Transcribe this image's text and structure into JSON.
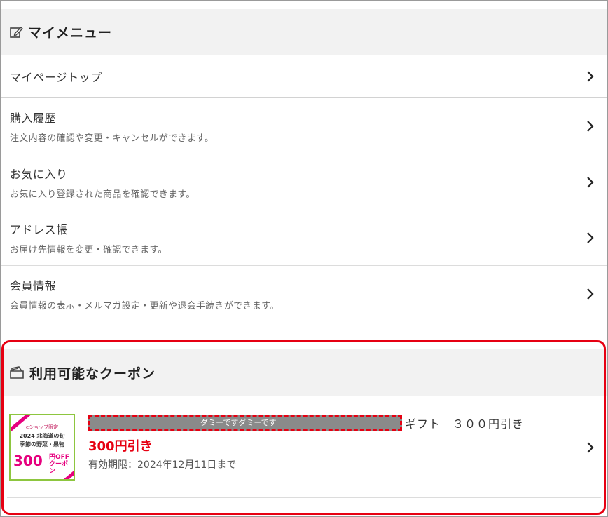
{
  "my_menu": {
    "title": "マイメニュー",
    "icon": "edit-note-icon",
    "items": [
      {
        "label": "マイページトップ",
        "description": ""
      },
      {
        "label": "購入履歴",
        "description": "注文内容の確認や変更・キャンセルができます。"
      },
      {
        "label": "お気に入り",
        "description": "お気に入り登録された商品を確認できます。"
      },
      {
        "label": "アドレス帳",
        "description": "お届け先情報を変更・確認できます。"
      },
      {
        "label": "会員情報",
        "description": "会員情報の表示・メルマガ設定・更新や退会手続きができます。"
      }
    ]
  },
  "coupons": {
    "title": "利用可能なクーポン",
    "icon": "coupon-icon",
    "items": [
      {
        "thumbnail": {
          "tag": "eショップ限定",
          "year_line": "2024 北海道の旬",
          "season_line": "季節の野菜・果物",
          "amount": "300",
          "unit_line1": "円OFF",
          "unit_line2": "クーポン"
        },
        "redacted_dummy": "ダミーですダミーです",
        "name_rest": "ギフト　３００円引き",
        "discount": "300円引き",
        "expiry": "有効期限：2024年12月11日まで"
      }
    ]
  },
  "colors": {
    "accent_red": "#e60012",
    "header_bg": "#f2f2f2",
    "thumb_pink": "#e6007e",
    "thumb_green": "#8dc63f"
  }
}
